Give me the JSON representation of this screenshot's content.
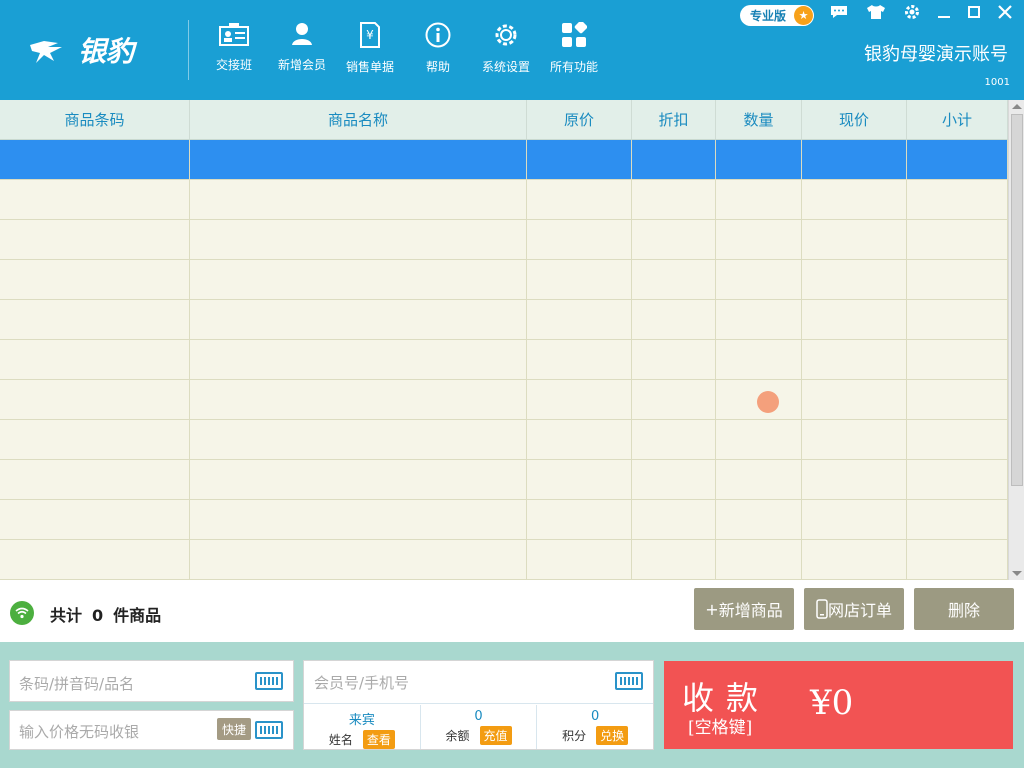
{
  "header": {
    "logo_text": "银豹",
    "pro_badge": "专业版",
    "account_name": "银豹母婴演示账号",
    "account_id": "1001",
    "nav": [
      {
        "label": "交接班",
        "icon": "shift-handover-icon"
      },
      {
        "label": "新增会员",
        "icon": "add-member-icon"
      },
      {
        "label": "销售单据",
        "icon": "sales-receipt-icon"
      },
      {
        "label": "帮助",
        "icon": "help-icon"
      },
      {
        "label": "系统设置",
        "icon": "settings-icon"
      },
      {
        "label": "所有功能",
        "icon": "all-functions-icon"
      }
    ]
  },
  "grid": {
    "columns": [
      "商品条码",
      "商品名称",
      "原价",
      "折扣",
      "数量",
      "现价",
      "小计"
    ]
  },
  "summary": {
    "prefix": "共计",
    "count": "0",
    "suffix": "件商品",
    "add_product": "新增商品",
    "online_order": "网店订单",
    "delete": "删除"
  },
  "inputs": {
    "barcode_placeholder": "条码/拼音码/品名",
    "price_placeholder": "输入价格无码收银",
    "quick_label": "快捷",
    "member_placeholder": "会员号/手机号"
  },
  "member": {
    "name_value": "来宾",
    "name_label": "姓名",
    "name_btn": "查看",
    "balance_value": "0",
    "balance_label": "余额",
    "balance_btn": "充值",
    "points_value": "0",
    "points_label": "积分",
    "points_btn": "兑换"
  },
  "pay": {
    "label": "收款",
    "hint": "[空格键]",
    "amount": "¥0"
  },
  "colors": {
    "header_bg": "#1a9fd4",
    "selected_row": "#2d8ff0",
    "pay_bg": "#f25353",
    "action_btn": "#9c9a82",
    "bottom_bg": "#a9d8cf"
  }
}
